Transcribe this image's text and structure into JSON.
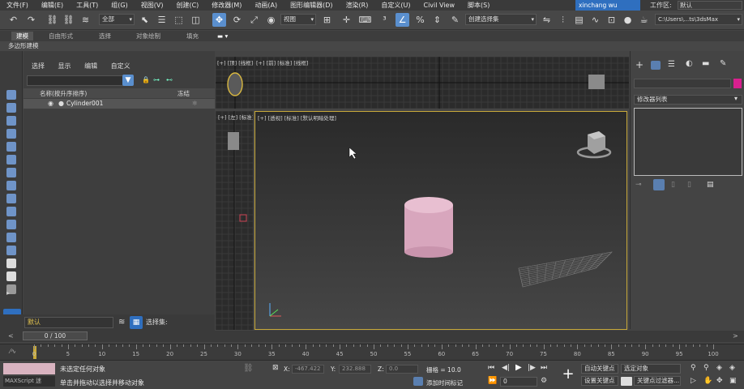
{
  "menu": [
    "文件(F)",
    "编辑(E)",
    "工具(T)",
    "组(G)",
    "视图(V)",
    "创建(C)",
    "修改器(M)",
    "动画(A)",
    "图形编辑器(D)",
    "渲染(R)",
    "自定义(U)",
    "Civil View",
    "脚本(S)"
  ],
  "user": "xinchang wu",
  "workspace": {
    "label": "工作区:",
    "value": "默认"
  },
  "toolbar": {
    "selection_filter": "全部",
    "ref_coord": "视图",
    "named_selection": "创建选择集",
    "path": "C:\\Users\\...ts\\3dsMax"
  },
  "ribbon": {
    "tabs": [
      "建模",
      "自由形式",
      "选择",
      "对象绘制",
      "填充"
    ],
    "active": "建模",
    "sub": "多边形建模"
  },
  "explorer": {
    "menu": [
      "选择",
      "显示",
      "编辑",
      "自定义"
    ],
    "col_name": "名称(按升序排序)",
    "col_frozen": "冻结",
    "object": "Cylinder001"
  },
  "layer": {
    "value": "默认",
    "selection_set_label": "选择集:"
  },
  "viewports": {
    "top": "[+] [顶] [线框]",
    "front": "[+] [前] [标准] [线框]",
    "left": "[+] [左] [标准]",
    "perspective": "[+] [透视] [标准] [默认明暗处理]"
  },
  "command_panel": {
    "modifier_list": "修改器列表",
    "color": "#d9208f"
  },
  "timeline": {
    "slider": "0 / 100",
    "ticks": [
      "0",
      "5",
      "10",
      "15",
      "20",
      "25",
      "30",
      "35",
      "40",
      "45",
      "50",
      "55",
      "60",
      "65",
      "70",
      "75",
      "80",
      "85",
      "90",
      "95",
      "100"
    ]
  },
  "status": {
    "maxscript": "MAXScript 迷",
    "line1": "未选定任何对象",
    "line2": "单击并拖动以选择并移动对象",
    "x_label": "X:",
    "x": "-467.422",
    "y_label": "Y:",
    "y": "232.888",
    "z_label": "Z:",
    "z": "0.0",
    "grid": "栅格 = 10.0",
    "add_time_tag": "添加时间标记",
    "auto_key": "自动关键点",
    "selected_obj": "选定对象",
    "set_key": "设置关键点",
    "key_filter": "关键点过滤器...",
    "frame": "0"
  }
}
